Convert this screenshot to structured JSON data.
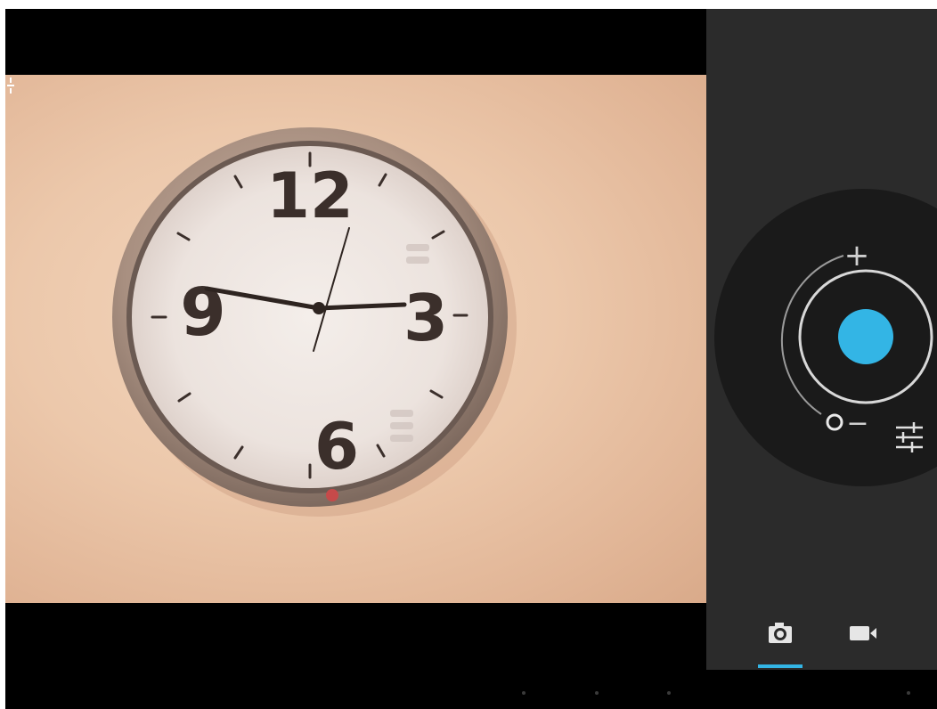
{
  "app": {
    "screen": "camera-viewfinder"
  },
  "viewfinder": {
    "subject": "wall-clock",
    "clock_numerals": [
      "12",
      "3",
      "6",
      "9"
    ],
    "overflow_icon": "overflow-menu-icon"
  },
  "controls": {
    "zoom_in_symbol": "+",
    "zoom_out_symbol": "−",
    "shutter_icon": "shutter-button",
    "settings_icon": "sliders-icon",
    "accent_color": "#33b5e5"
  },
  "modes": {
    "items": [
      {
        "icon": "camera-icon",
        "selected": true
      },
      {
        "icon": "video-camera-icon",
        "selected": false
      }
    ]
  },
  "navbar": {
    "icons": [
      "back-icon",
      "home-icon",
      "recents-icon",
      "menu-icon"
    ]
  }
}
